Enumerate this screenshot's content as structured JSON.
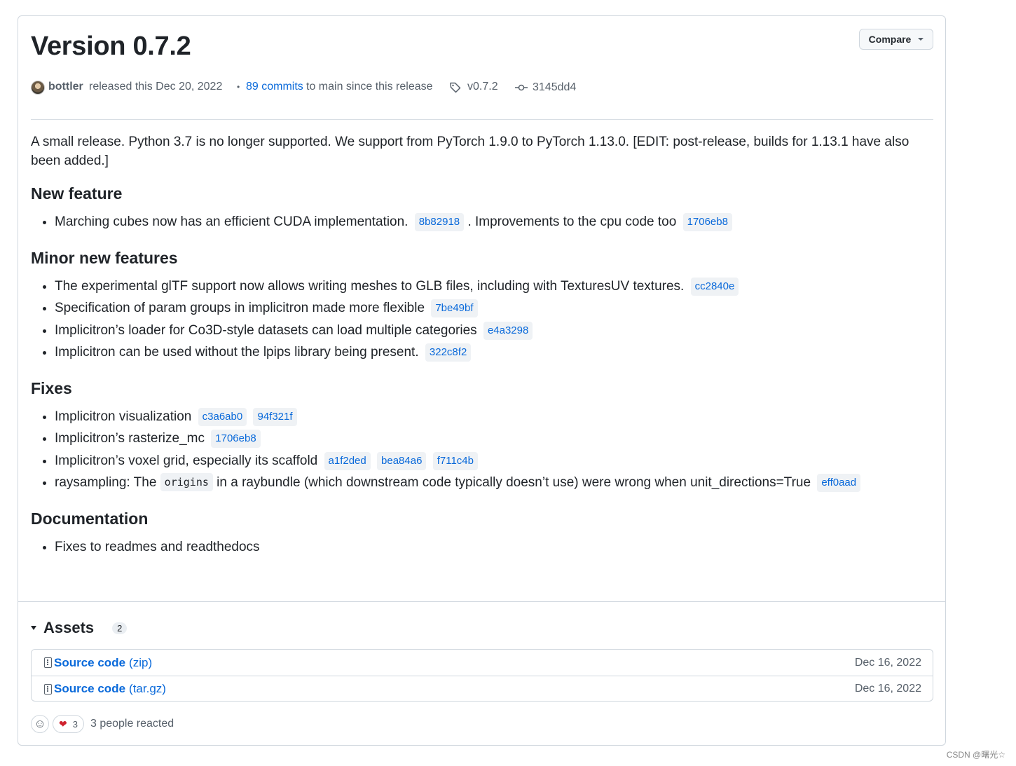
{
  "release": {
    "title": "Version 0.7.2",
    "compare_label": "Compare",
    "author": "bottler",
    "released_text": "released this Dec 20, 2022",
    "commits_link": "89 commits",
    "commits_suffix": "to main since this release",
    "tag": "v0.7.2",
    "commit": "3145dd4"
  },
  "notes": {
    "intro": "A small release. Python 3.7 is no longer supported. We support from PyTorch 1.9.0 to PyTorch 1.13.0. [EDIT: post-release, builds for 1.13.1 have also been added.]",
    "new_feature": {
      "heading": "New feature",
      "item1_text_a": "Marching cubes now has an efficient CUDA implementation.",
      "item1_sha_a": "8b82918",
      "item1_text_b": ". Improvements to the cpu code too",
      "item1_sha_b": "1706eb8"
    },
    "minor": {
      "heading": "Minor new features",
      "items": [
        {
          "text": "The experimental glTF support now allows writing meshes to GLB files, including with TexturesUV textures.",
          "sha": "cc2840e"
        },
        {
          "text": "Specification of param groups in implicitron made more flexible",
          "sha": "7be49bf"
        },
        {
          "text": "Implicitron’s loader for Co3D-style datasets can load multiple categories",
          "sha": "e4a3298"
        },
        {
          "text": "Implicitron can be used without the lpips library being present.",
          "sha": "322c8f2"
        }
      ]
    },
    "fixes": {
      "heading": "Fixes",
      "item1_text": "Implicitron visualization",
      "item1_sha_a": "c3a6ab0",
      "item1_sha_b": "94f321f",
      "item2_text": "Implicitron’s rasterize_mc",
      "item2_sha": "1706eb8",
      "item3_text": "Implicitron’s voxel grid, especially its scaffold",
      "item3_sha_a": "a1f2ded",
      "item3_sha_b": "bea84a6",
      "item3_sha_c": "f711c4b",
      "item4_text_a": "raysampling: The",
      "item4_code": "origins",
      "item4_text_b": "in a raybundle (which downstream code typically doesn’t use) were wrong when unit_directions=True",
      "item4_sha": "eff0aad"
    },
    "docs": {
      "heading": "Documentation",
      "item1": "Fixes to readmes and readthedocs"
    }
  },
  "assets": {
    "title": "Assets",
    "count": "2",
    "items": [
      {
        "name": "Source code",
        "format": "(zip)",
        "date": "Dec 16, 2022"
      },
      {
        "name": "Source code",
        "format": "(tar.gz)",
        "date": "Dec 16, 2022"
      }
    ]
  },
  "reactions": {
    "heart_count": "3",
    "summary": "3 people reacted"
  },
  "watermark": "CSDN @曙光☆"
}
